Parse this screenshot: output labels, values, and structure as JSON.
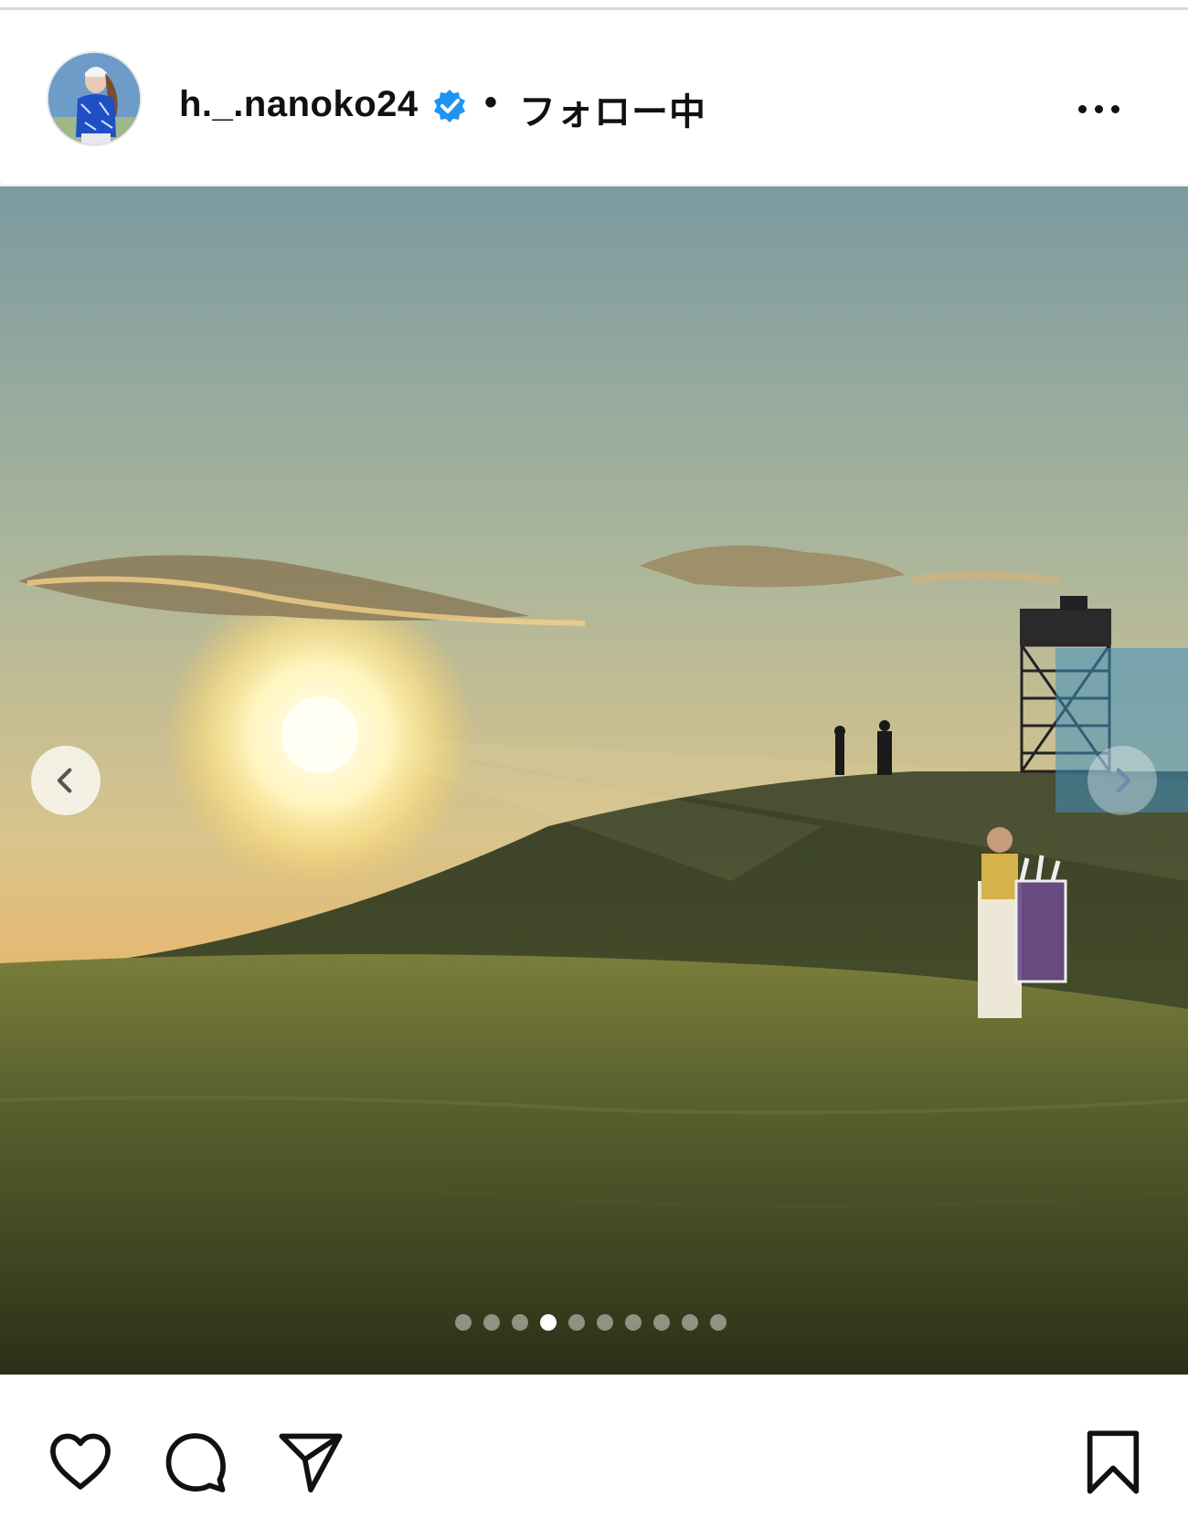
{
  "post": {
    "username": "h._.nanoko24",
    "separator": "•",
    "follow_status": "フォロー中",
    "verified_icon": "verified-badge-icon",
    "more_icon": "more-options-icon"
  },
  "carousel": {
    "total_slides": 10,
    "active_slide": 4,
    "prev_icon": "chevron-left-icon",
    "next_icon": "chevron-right-icon"
  },
  "actions": {
    "like_icon": "heart-icon",
    "comment_icon": "comment-icon",
    "share_icon": "send-icon",
    "save_icon": "bookmark-icon"
  },
  "colors": {
    "verified": "#1f93f0",
    "text": "#111111"
  }
}
